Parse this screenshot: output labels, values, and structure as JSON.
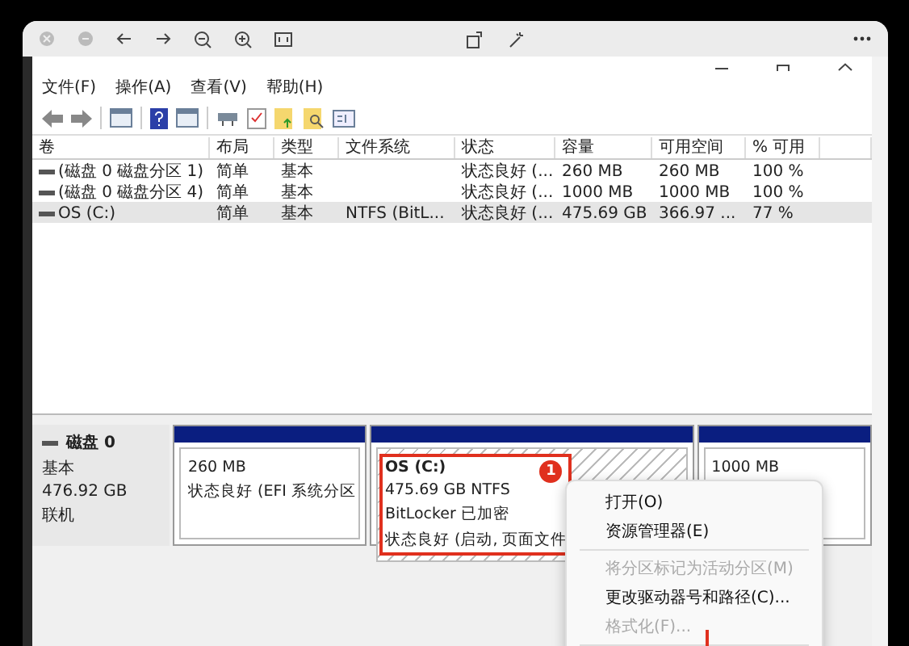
{
  "menu_bar": [
    {
      "label": "文件(F)"
    },
    {
      "label": "操作(A)"
    },
    {
      "label": "查看(V)"
    },
    {
      "label": "帮助(H)"
    }
  ],
  "table": {
    "columns": [
      "卷",
      "布局",
      "类型",
      "文件系统",
      "状态",
      "容量",
      "可用空间",
      "% 可用"
    ],
    "rows": [
      {
        "cells": [
          "(磁盘 0 磁盘分区 1)",
          "简单",
          "基本",
          "",
          "状态良好 (...",
          "260 MB",
          "260 MB",
          "100 %"
        ],
        "selected": false
      },
      {
        "cells": [
          "(磁盘 0 磁盘分区 4)",
          "简单",
          "基本",
          "",
          "状态良好 (...",
          "1000 MB",
          "1000 MB",
          "100 %"
        ],
        "selected": false
      },
      {
        "cells": [
          "OS (C:)",
          "简单",
          "基本",
          "NTFS (BitL...",
          "状态良好 (...",
          "475.69 GB",
          "366.97 ...",
          "77 %"
        ],
        "selected": true
      }
    ]
  },
  "disk": {
    "name": "磁盘 0",
    "type": "基本",
    "size": "476.92 GB",
    "status": "联机",
    "partitions": [
      {
        "kind": "plain",
        "lines": [
          "260 MB",
          "状态良好 (EFI 系统分区"
        ],
        "highlighted": false
      },
      {
        "kind": "hatched",
        "label": "OS  (C:)",
        "lines": [
          "475.69 GB NTFS",
          "BitLocker 已加密",
          "状态良好 (启动, 页面文件"
        ],
        "highlighted": true,
        "badge": "1"
      },
      {
        "kind": "plain",
        "lines": [
          "1000 MB"
        ],
        "highlighted": false
      }
    ]
  },
  "context_menu": [
    {
      "kind": "item",
      "label": "打开(O)",
      "disabled": false
    },
    {
      "kind": "item",
      "label": "资源管理器(E)",
      "disabled": false
    },
    {
      "kind": "separator"
    },
    {
      "kind": "item",
      "label": "将分区标记为活动分区(M)",
      "disabled": true
    },
    {
      "kind": "item",
      "label": "更改驱动器号和路径(C)...",
      "disabled": false
    },
    {
      "kind": "item",
      "label": "格式化(F)...",
      "disabled": true
    },
    {
      "kind": "separator"
    }
  ]
}
